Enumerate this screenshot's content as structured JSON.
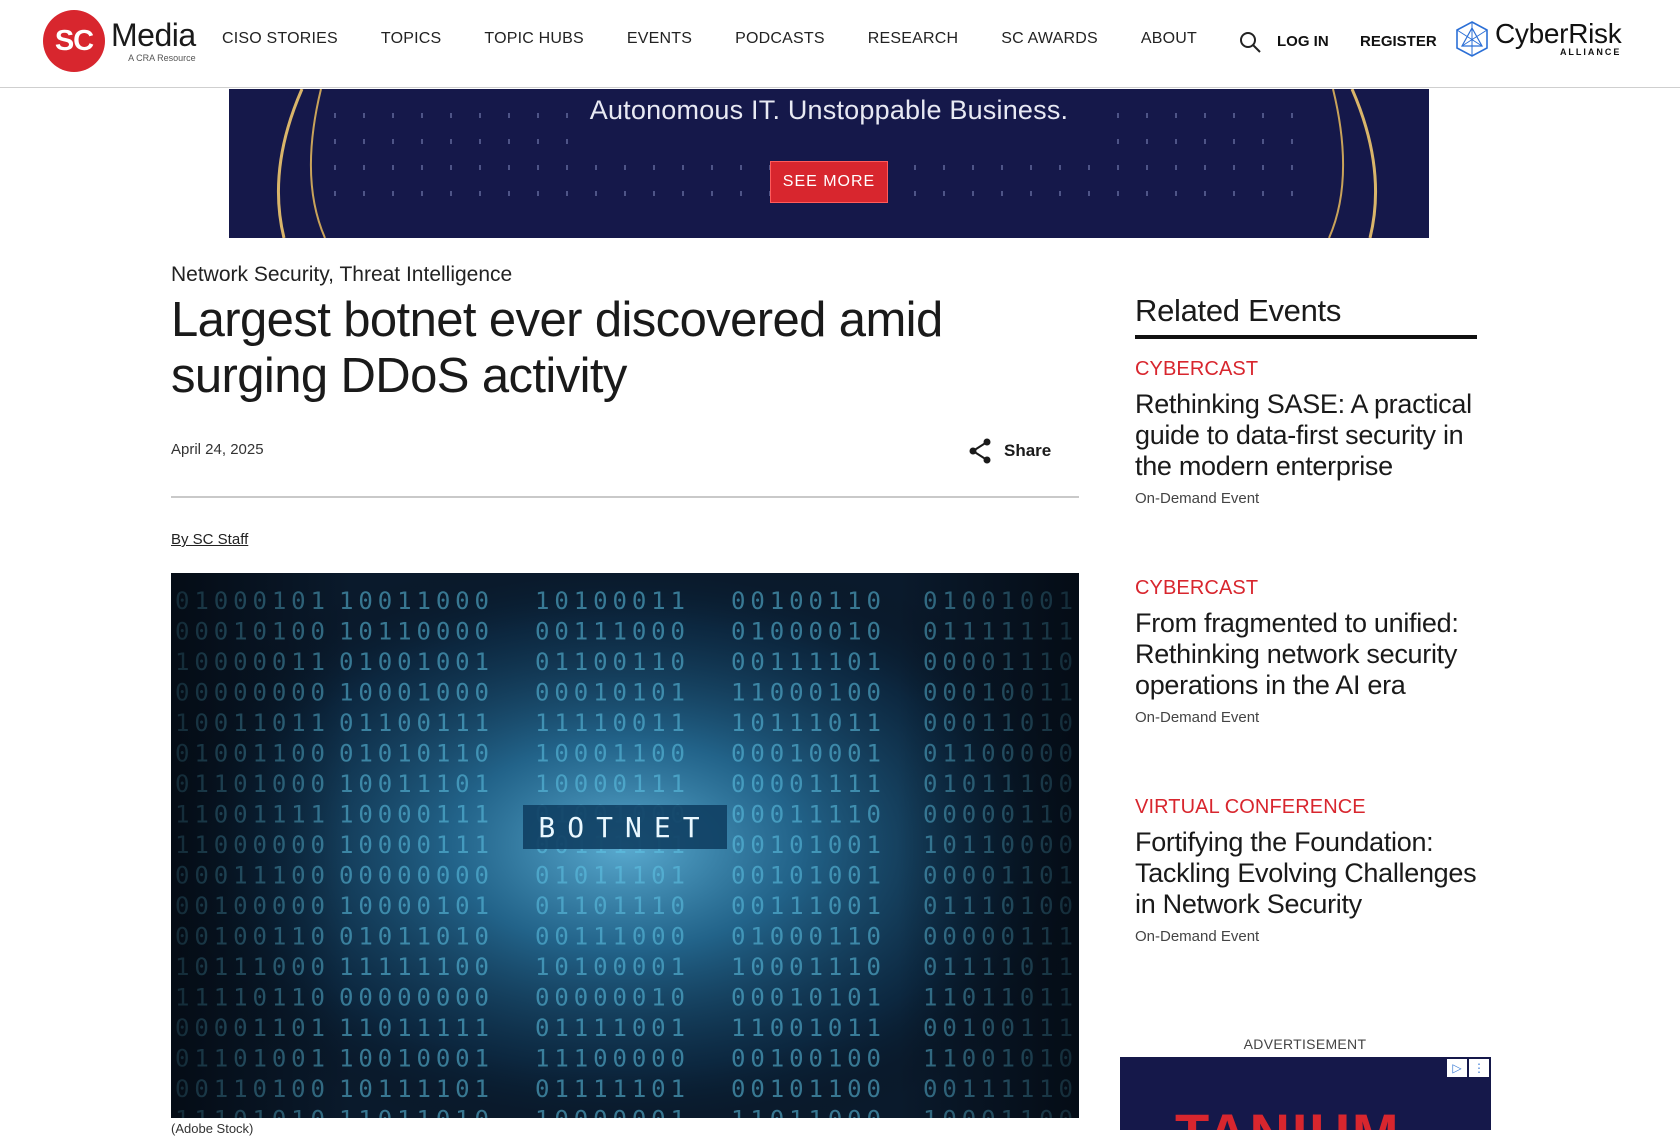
{
  "nav": {
    "logo_mark": "SC",
    "logo_word": "Media",
    "logo_sub": "A CRA Resource",
    "items": [
      "CISO STORIES",
      "TOPICS",
      "TOPIC HUBS",
      "EVENTS",
      "PODCASTS",
      "RESEARCH",
      "SC AWARDS",
      "ABOUT"
    ],
    "login": "LOG IN",
    "register": "REGISTER",
    "cra_word": "CyberRisk",
    "cra_sub": "ALLIANCE"
  },
  "banner_ad": {
    "headline": "Autonomous IT. Unstoppable Business.",
    "button": "SEE MORE"
  },
  "article": {
    "categories": "Network Security, Threat Intelligence",
    "headline": "Largest botnet ever discovered amid surging DDoS activity",
    "date": "April 24, 2025",
    "share_label": "Share",
    "byline": "By SC Staff",
    "hero_word": "BOTNET",
    "caption": "(Adobe Stock)"
  },
  "sidebar": {
    "title": "Related Events",
    "events": [
      {
        "type": "CYBERCAST",
        "title": "Rethinking SASE: A practical guide to data-first security in the modern enterprise",
        "sub": "On-Demand Event"
      },
      {
        "type": "CYBERCAST",
        "title": "From fragmented to unified: Rethinking network security operations in the AI era",
        "sub": "On-Demand Event"
      },
      {
        "type": "VIRTUAL CONFERENCE",
        "title": "Fortifying the Foundation: Tackling Evolving Challenges in Network Security",
        "sub": "On-Demand Event"
      }
    ],
    "ad_label": "ADVERTISEMENT",
    "ad_word": "TANIUM"
  },
  "colors": {
    "brand_red": "#d8262e",
    "ad_navy": "#15184a"
  }
}
